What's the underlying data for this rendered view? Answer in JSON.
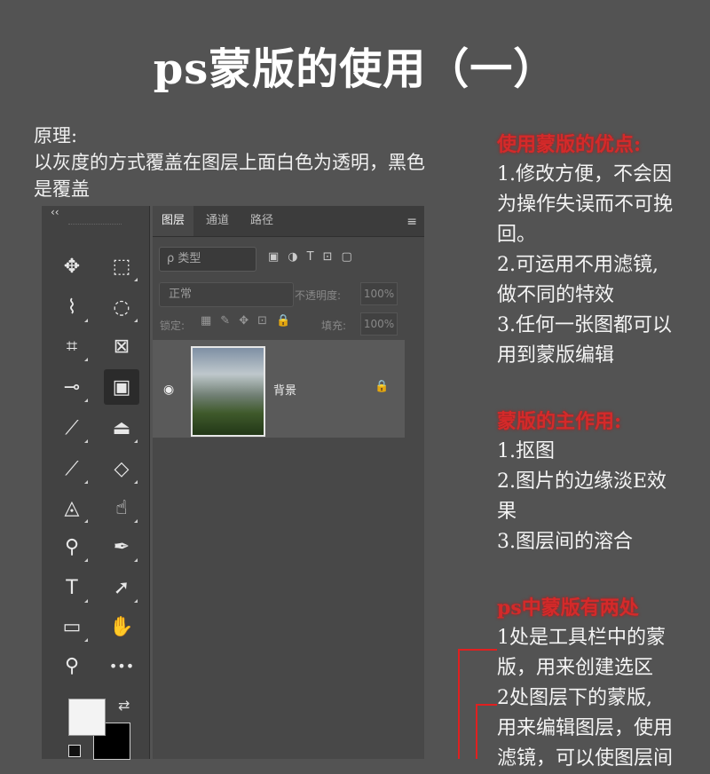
{
  "title": "ps蒙版的使用（一）",
  "principle": {
    "line1": "原理:",
    "line2": "以灰度的方式覆盖在图层上面白色为透明，黑色",
    "line3": "是覆盖"
  },
  "notes": {
    "sec1": {
      "head": "使用蒙版的优点:",
      "items": [
        "1.修改方便，不会因",
        "为操作失误而不可挽",
        "回。",
        "2.可运用不用滤镜,",
        "做不同的特效",
        "3.任何一张图都可以",
        "用到蒙版编辑"
      ]
    },
    "sec2": {
      "head": "蒙版的主作用:",
      "items": [
        "1.抠图",
        "2.图片的边缘淡E效",
        "果",
        "3.图层间的溶合"
      ]
    },
    "sec3": {
      "head": "ps中蒙版有两处",
      "items": [
        "1处是工具栏中的蒙",
        "版，用来创建选区",
        "2处图层下的蒙版,",
        "用来编辑图层，使用",
        "滤镜，可以使图层间"
      ]
    }
  },
  "toolbar": {
    "collapse": "‹‹",
    "tools": [
      {
        "name": "move-tool",
        "glyph": "✥"
      },
      {
        "name": "marquee-tool",
        "glyph": "⬚"
      },
      {
        "name": "lasso-tool",
        "glyph": "⌇"
      },
      {
        "name": "quick-select-tool",
        "glyph": "◌"
      },
      {
        "name": "crop-tool",
        "glyph": "⌗"
      },
      {
        "name": "frame-tool",
        "glyph": "⊠"
      },
      {
        "name": "eyedropper-tool",
        "glyph": "⊸"
      },
      {
        "name": "quick-mask-tool",
        "glyph": "▣"
      },
      {
        "name": "brush-tool",
        "glyph": "⟋"
      },
      {
        "name": "stamp-tool",
        "glyph": "⏏"
      },
      {
        "name": "history-brush-tool",
        "glyph": "⟋"
      },
      {
        "name": "eraser-tool",
        "glyph": "◇"
      },
      {
        "name": "paint-bucket-tool",
        "glyph": "◬"
      },
      {
        "name": "smudge-tool",
        "glyph": "☝"
      },
      {
        "name": "dodge-tool",
        "glyph": "⚲"
      },
      {
        "name": "pen-tool",
        "glyph": "✒"
      },
      {
        "name": "type-tool",
        "glyph": "T"
      },
      {
        "name": "path-select-tool",
        "glyph": "➚"
      },
      {
        "name": "rectangle-tool",
        "glyph": "▭"
      },
      {
        "name": "hand-tool",
        "glyph": "✋"
      },
      {
        "name": "zoom-tool",
        "glyph": "⚲"
      },
      {
        "name": "more-tools",
        "glyph": "•••"
      }
    ],
    "swap": "⇄"
  },
  "panel": {
    "tabs": [
      "图层",
      "通道",
      "路径"
    ],
    "active_tab": 0,
    "menu": "≡",
    "search_placeholder": "ρ 类型",
    "filter_icons": [
      "▣",
      "◑",
      "T",
      "⊡",
      "▢"
    ],
    "blend_mode": "正常",
    "opacity_label": "不透明度:",
    "opacity_value": "100%",
    "lock_label": "锁定:",
    "lock_icons": [
      "▦",
      "✎",
      "✥",
      "⊡",
      "🔒"
    ],
    "fill_label": "填充:",
    "fill_value": "100%",
    "layer": {
      "name": "背景",
      "eye": "◉",
      "lock": "🔒"
    }
  },
  "colors": {
    "accent_red": "#d42a2a",
    "background": "#535353"
  }
}
